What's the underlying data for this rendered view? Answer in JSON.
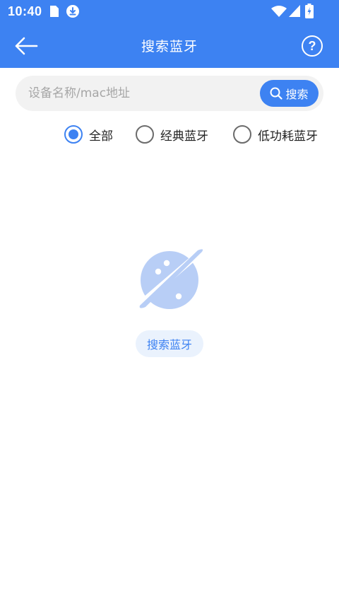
{
  "status_bar": {
    "time": "10:40",
    "icons": [
      "sim-card-icon",
      "download-icon",
      "wifi-icon",
      "cellular-signal-icon",
      "battery-charging-icon"
    ]
  },
  "toolbar": {
    "title": "搜索蓝牙",
    "back_icon": "arrow-left-icon",
    "help_icon": "question-circle-icon",
    "help_glyph": "?"
  },
  "search": {
    "placeholder": "设备名称/mac地址",
    "value": "",
    "button_label": "搜索",
    "button_icon": "search-icon"
  },
  "filters": {
    "options": [
      {
        "label": "全部",
        "checked": true
      },
      {
        "label": "经典蓝牙",
        "checked": false
      },
      {
        "label": "低功耗蓝牙",
        "checked": false
      }
    ]
  },
  "empty_state": {
    "illustration": "planet-icon",
    "button_label": "搜索蓝牙"
  },
  "colors": {
    "primary": "#3d82f2",
    "illustration": "#b8cef6",
    "empty_button_bg": "#eaf2fd",
    "search_bg": "#f2f2f2"
  }
}
